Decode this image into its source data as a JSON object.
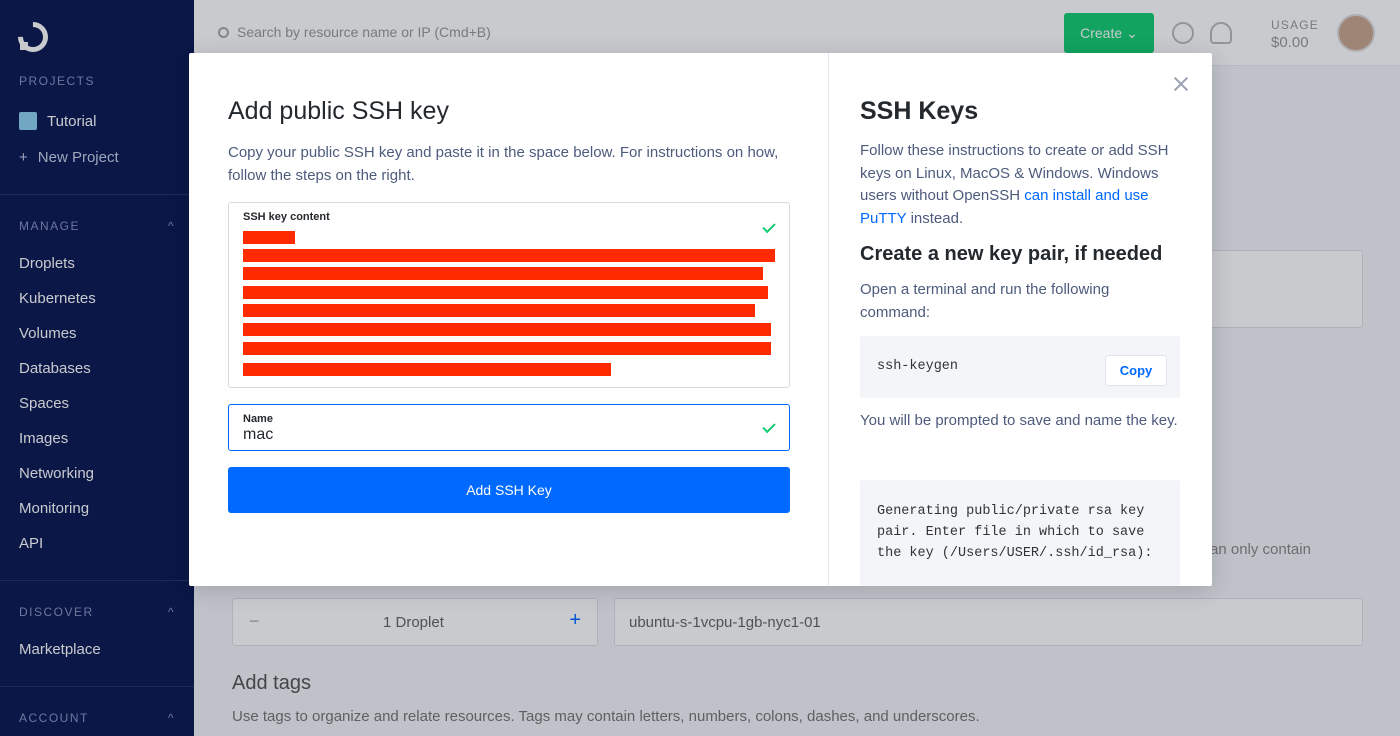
{
  "sidebar": {
    "projects_title": "PROJECTS",
    "projects": [
      {
        "label": "Tutorial"
      }
    ],
    "new_project": "New Project",
    "manage_title": "MANAGE",
    "manage_items": [
      "Droplets",
      "Kubernetes",
      "Volumes",
      "Databases",
      "Spaces",
      "Images",
      "Networking",
      "Monitoring",
      "API"
    ],
    "discover_title": "DISCOVER",
    "discover_items": [
      "Marketplace"
    ],
    "account_title": "ACCOUNT"
  },
  "topbar": {
    "search_placeholder": "Search by resource name or IP (Cmd+B)",
    "create_label": "Create",
    "usage_label": "USAGE",
    "usage_value": "$0.00"
  },
  "background": {
    "droplet_count": "1 Droplet",
    "hostname": "ubuntu-s-1vcpu-1gb-nyc1-01",
    "partial_text": "an only contain",
    "tags_title": "Add tags",
    "tags_desc": "Use tags to organize and relate resources. Tags may contain letters, numbers, colons, dashes, and underscores."
  },
  "modal": {
    "title": "Add public SSH key",
    "description": "Copy your public SSH key and paste it in the space below. For instructions on how, follow the steps on the right.",
    "key_field_label": "SSH key content",
    "name_field_label": "Name",
    "name_value": "mac",
    "submit_label": "Add SSH Key",
    "help": {
      "title": "SSH Keys",
      "intro_before_link": "Follow these instructions to create or add SSH keys on Linux, MacOS & Windows. Windows users without OpenSSH ",
      "intro_link": "can install and use PuTTY",
      "intro_after_link": " instead.",
      "subtitle": "Create a new key pair, if needed",
      "step1": "Open a terminal and run the following command:",
      "command": "ssh-keygen",
      "copy_label": "Copy",
      "step2": "You will be prompted to save and name the key.",
      "output": "Generating public/private rsa key pair. Enter file in which to save the key (/Users/USER/.ssh/id_rsa):"
    }
  },
  "colors": {
    "primary": "#0069ff",
    "success": "#15cd72",
    "redaction": "#ff2a00",
    "sidebar": "#0b1a52"
  }
}
